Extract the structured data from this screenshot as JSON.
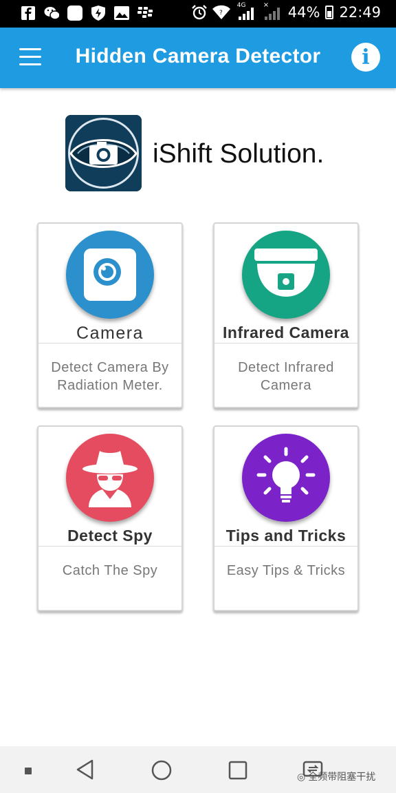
{
  "status_bar": {
    "battery_percent": "44%",
    "time": "22:49",
    "network_label": "4G",
    "icons": [
      "facebook-icon",
      "wechat-icon",
      "app-icon",
      "shield-icon",
      "gallery-icon",
      "bbm-icon",
      "alarm-icon",
      "wifi-icon",
      "signal-icon",
      "signal-x-icon",
      "battery-icon"
    ]
  },
  "app_bar": {
    "title": "Hidden Camera Detector",
    "menu_icon": "hamburger-menu-icon",
    "info_icon": "info-icon",
    "info_glyph": "i",
    "color": "#1e9be1"
  },
  "brand": {
    "company_name": "iShift Solution.",
    "logo_icon": "eye-camera-logo-icon"
  },
  "cards": [
    {
      "title": "Camera",
      "description": "Detect Camera By Radiation Meter.",
      "icon": "camera-icon",
      "color": "#2b90cc"
    },
    {
      "title": "Infrared Camera",
      "description": "Detect Infrared Camera",
      "icon": "dome-camera-icon",
      "color": "#16a584"
    },
    {
      "title": "Detect Spy",
      "description": "Catch The Spy",
      "icon": "spy-icon",
      "color": "#e54c60"
    },
    {
      "title": "Tips and Tricks",
      "description": "Easy Tips & Tricks",
      "icon": "lightbulb-icon",
      "color": "#7b22c9"
    }
  ],
  "nav_bar": {
    "icons": [
      "small-square-icon",
      "back-icon",
      "home-icon",
      "recents-icon",
      "screen-switch-icon"
    ],
    "watermark": "全频带阻塞干扰"
  }
}
